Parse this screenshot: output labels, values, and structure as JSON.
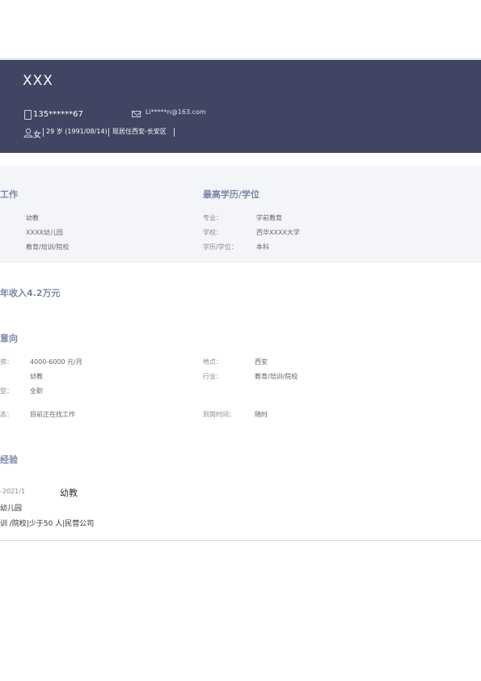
{
  "header": {
    "name": "XXX",
    "phone": "135******67",
    "email": "Li*****n@163.com",
    "gender": "女",
    "age_birth": "29 岁 (1991/08/14)",
    "residence": "现居住西安-长安区"
  },
  "recent_work": {
    "title": "工作",
    "position": "幼教",
    "company": "XXXX幼儿园",
    "industry": "教育/培训/院校"
  },
  "education": {
    "title": "最高学历/学位",
    "major_label": "专业：",
    "major": "学前教育",
    "school_label": "学校：",
    "school": "西华XXXX大学",
    "degree_label": "学历/学位：",
    "degree": "本科"
  },
  "income": {
    "text": "年收入4.2万元"
  },
  "intention": {
    "title": "意向",
    "salary_label": "资：",
    "salary": "4000-6000  元/月",
    "location_label": "地点：",
    "location": "西安",
    "job": "幼教",
    "industry_label": "行业：",
    "industry": "教育/培训/院校",
    "type_label": "型：",
    "type": "全职",
    "status_label": "态：",
    "status": "目前正在找工作",
    "arrival_label": "到岗时间：",
    "arrival": "随时"
  },
  "experience": {
    "title": "经验",
    "date": "-2021/1",
    "position": "幼教",
    "company": "幼儿园",
    "details": "训 /院校|少于50 人|民营公司"
  }
}
